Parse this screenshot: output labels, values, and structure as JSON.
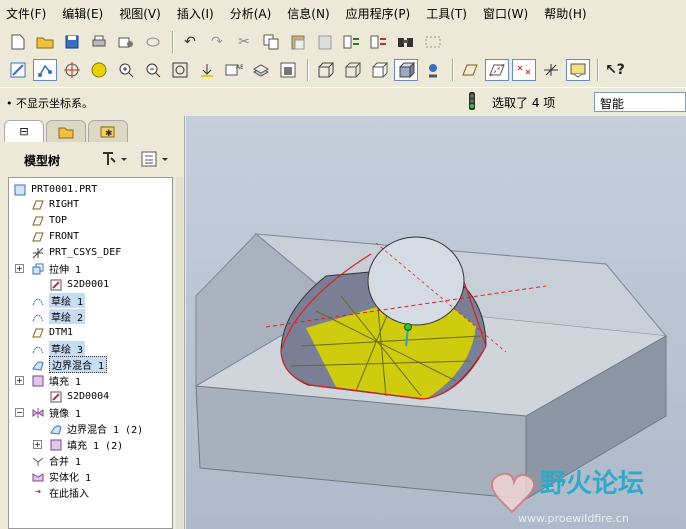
{
  "menubar": {
    "items": [
      "文件(F)",
      "编辑(E)",
      "视图(V)",
      "插入(I)",
      "分析(A)",
      "信息(N)",
      "应用程序(P)",
      "工具(T)",
      "窗口(W)",
      "帮助(H)"
    ]
  },
  "toolbar1": {
    "icons": [
      "new-file-icon",
      "open-file-icon",
      "save-icon",
      "print-icon",
      "send-icon",
      "link-icon",
      "undo-icon",
      "redo-icon",
      "cut-icon",
      "copy-icon",
      "paste-icon",
      "paste-special-icon",
      "regenerate-icon",
      "regen-manager-icon",
      "find-icon",
      "select-box-icon"
    ]
  },
  "toolbar2": {
    "icons": [
      "repaint-icon",
      "orient-icon",
      "spin-center-icon",
      "appearance-icon",
      "zoom-in-icon",
      "zoom-out-icon",
      "refit-icon",
      "reorient-icon",
      "saved-views-icon",
      "layers-icon",
      "view-manager-icon",
      "wireframe-icon",
      "hidden-line-icon",
      "no-hidden-icon",
      "shading-icon",
      "model-display-icon",
      "plane-display-icon",
      "axis-display-icon",
      "point-display-icon",
      "csys-display-icon",
      "annotation-display-icon",
      "whats-this-icon"
    ]
  },
  "status": {
    "message": "• 不显示坐标系。",
    "selected": "选取了 4 项",
    "filter": "智能"
  },
  "left_panel": {
    "title": "模型树"
  },
  "tree": {
    "items": [
      {
        "label": "PRT0001.PRT",
        "icon": "part-icon"
      },
      {
        "label": "RIGHT",
        "icon": "datum-plane-icon"
      },
      {
        "label": "TOP",
        "icon": "datum-plane-icon"
      },
      {
        "label": "FRONT",
        "icon": "datum-plane-icon"
      },
      {
        "label": "PRT_CSYS_DEF",
        "icon": "csys-icon"
      },
      {
        "label": "拉伸 1",
        "icon": "extrude-icon"
      },
      {
        "label": "S2D0001",
        "icon": "sketch-icon"
      },
      {
        "label": "草绘 1",
        "icon": "sketch-curve-icon"
      },
      {
        "label": "草绘 2",
        "icon": "sketch-curve-icon"
      },
      {
        "label": "DTM1",
        "icon": "datum-plane-icon"
      },
      {
        "label": "草绘 3",
        "icon": "sketch-curve-icon"
      },
      {
        "label": "边界混合 1",
        "icon": "boundary-blend-icon"
      },
      {
        "label": "填充 1",
        "icon": "fill-icon"
      },
      {
        "label": "S2D0004",
        "icon": "sketch-icon"
      },
      {
        "label": "镜像 1",
        "icon": "mirror-icon"
      },
      {
        "label": "边界混合 1 (2)",
        "icon": "boundary-blend-icon"
      },
      {
        "label": "填充 1 (2)",
        "icon": "fill-icon"
      },
      {
        "label": "合并 1",
        "icon": "merge-icon"
      },
      {
        "label": "实体化 1",
        "icon": "solidify-icon"
      },
      {
        "label": "在此插入",
        "icon": "insert-arrow-icon"
      }
    ]
  },
  "watermark": {
    "text": "野火论坛",
    "url": "www.proewildfire.cn"
  },
  "colors": {
    "surface_yellow": "#d8d400",
    "selection_red": "#e02020",
    "background_gradient": "#adbacb"
  }
}
